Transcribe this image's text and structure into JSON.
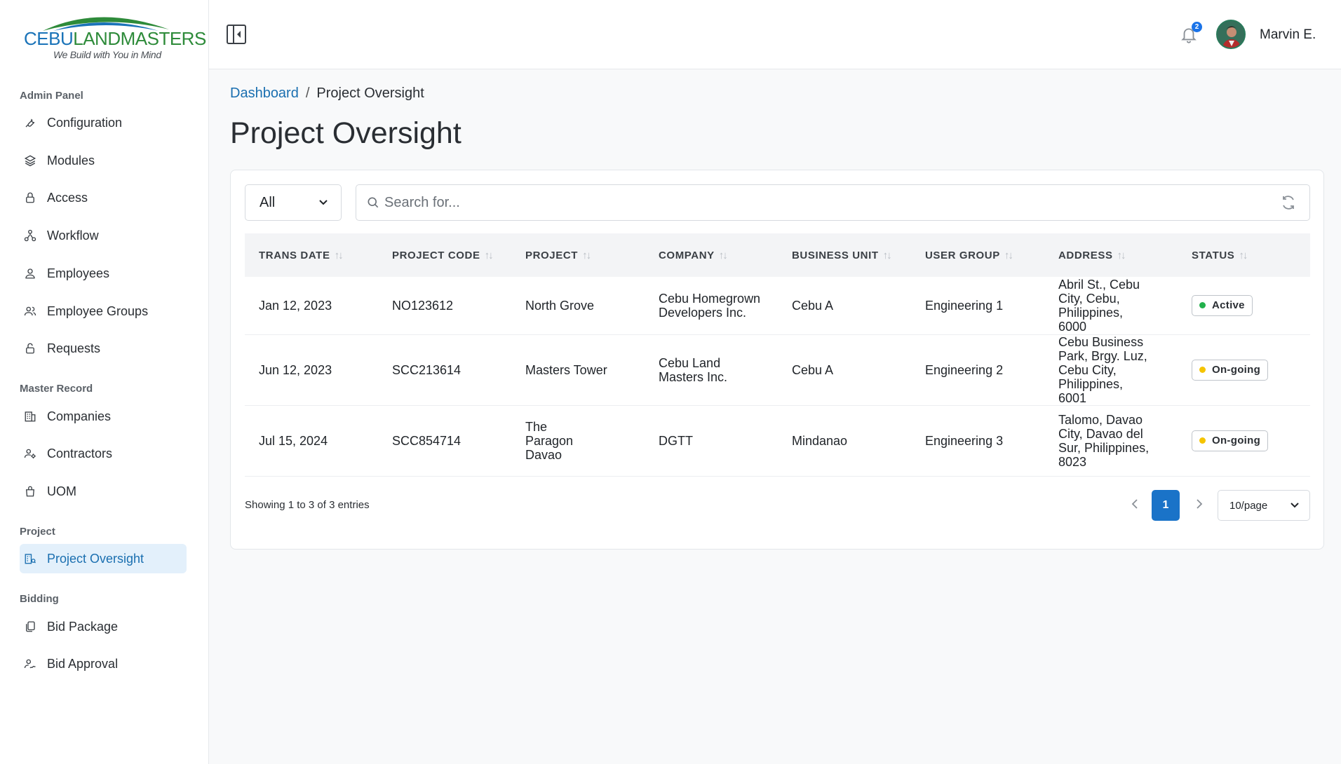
{
  "logo": {
    "brand_part1": "CEBU",
    "brand_part2": "LANDMASTERS",
    "tagline": "We Build with You in Mind"
  },
  "sidebar": {
    "sections": [
      {
        "label": "Admin Panel"
      },
      {
        "label": "Master Record"
      },
      {
        "label": "Project"
      },
      {
        "label": "Bidding"
      }
    ],
    "items": [
      {
        "label": "Configuration",
        "icon": "wrench-icon"
      },
      {
        "label": "Modules",
        "icon": "layers-icon"
      },
      {
        "label": "Access",
        "icon": "lock-icon"
      },
      {
        "label": "Workflow",
        "icon": "workflow-icon"
      },
      {
        "label": "Employees",
        "icon": "user-icon"
      },
      {
        "label": "Employee Groups",
        "icon": "users-icon"
      },
      {
        "label": "Requests",
        "icon": "unlock-icon"
      },
      {
        "label": "Companies",
        "icon": "building-icon"
      },
      {
        "label": "Contractors",
        "icon": "user-gear-icon"
      },
      {
        "label": "UOM",
        "icon": "bag-icon"
      },
      {
        "label": "Project Oversight",
        "icon": "building-search-icon",
        "active": true
      },
      {
        "label": "Bid Package",
        "icon": "copy-icon"
      },
      {
        "label": "Bid Approval",
        "icon": "user-sign-icon"
      }
    ]
  },
  "topbar": {
    "notification_count": "2",
    "username": "Marvin E."
  },
  "breadcrumb": {
    "home": "Dashboard",
    "separator": "/",
    "current": "Project Oversight"
  },
  "page_title": "Project Oversight",
  "filter": {
    "selected": "All"
  },
  "search": {
    "placeholder": "Search for..."
  },
  "table": {
    "columns": [
      "TRANS DATE",
      "PROJECT CODE",
      "PROJECT",
      "COMPANY",
      "BUSINESS UNIT",
      "USER GROUP",
      "ADDRESS",
      "STATUS"
    ],
    "rows": [
      {
        "trans_date": "Jan 12, 2023",
        "project_code": "NO123612",
        "project": "North Grove",
        "company": "Cebu Homegrown Developers Inc.",
        "business_unit": "Cebu A",
        "user_group": "Engineering 1",
        "address": "Abril St., Cebu City, Cebu, Philippines, 6000",
        "status": "Active",
        "status_color": "#22b14c"
      },
      {
        "trans_date": "Jun 12, 2023",
        "project_code": "SCC213614",
        "project": "Masters Tower",
        "company": "Cebu Land Masters Inc.",
        "business_unit": "Cebu A",
        "user_group": "Engineering 2",
        "address": "Cebu Business Park, Brgy. Luz, Cebu City, Philippines, 6001",
        "status": "On-going",
        "status_color": "#f5c400"
      },
      {
        "trans_date": "Jul 15, 2024",
        "project_code": "SCC854714",
        "project": "The Paragon Davao",
        "company": "DGTT",
        "business_unit": "Mindanao",
        "user_group": "Engineering 3",
        "address": "Talomo, Davao City, Davao del Sur, Philippines, 8023",
        "status": "On-going",
        "status_color": "#f5c400"
      }
    ]
  },
  "pagination": {
    "info": "Showing 1 to 3 of 3 entries",
    "current_page": "1",
    "page_size": "10/page"
  },
  "colors": {
    "primary": "#1a73c8",
    "active_bg": "#e3f0fb",
    "brand_blue": "#1a73b8",
    "brand_green": "#2e8b3a"
  }
}
